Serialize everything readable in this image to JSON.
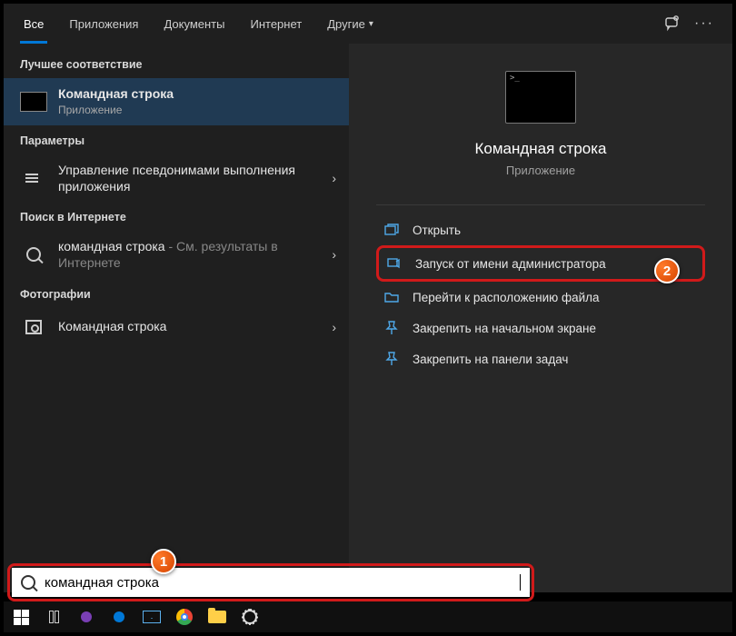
{
  "tabs": {
    "all": "Все",
    "apps": "Приложения",
    "docs": "Документы",
    "web": "Интернет",
    "more": "Другие"
  },
  "left": {
    "best_match": "Лучшее соответствие",
    "app_name": "Командная строка",
    "app_sub": "Приложение",
    "settings_label": "Параметры",
    "alias_setting": "Управление псевдонимами выполнения приложения",
    "web_label": "Поиск в Интернете",
    "web_query": "командная строка",
    "web_suffix": " - См. результаты в Интернете",
    "photos_label": "Фотографии",
    "photo_item": "Командная строка"
  },
  "right": {
    "title": "Командная строка",
    "sub": "Приложение",
    "actions": {
      "open": "Открыть",
      "admin": "Запуск от имени администратора",
      "location": "Перейти к расположению файла",
      "pin_start": "Закрепить на начальном экране",
      "pin_taskbar": "Закрепить на панели задач"
    }
  },
  "search": {
    "value": "командная строка"
  },
  "badges": {
    "one": "1",
    "two": "2"
  }
}
